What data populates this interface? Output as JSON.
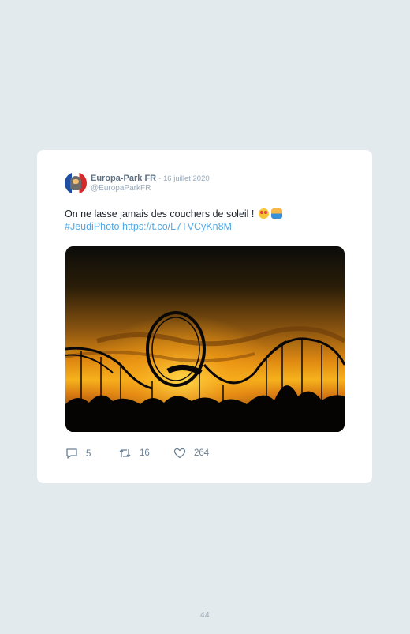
{
  "tweet": {
    "display_name": "Europa-Park FR",
    "date": "16 juillet 2020",
    "handle": "@EuropaParkFR",
    "text": "On ne lasse jamais des couchers de soleil !",
    "emojis": [
      "heart-eyes-emoji",
      "sunrise-emoji"
    ],
    "hashtag": "#JeudiPhoto",
    "link": "https://t.co/L7TVCyKn8M",
    "photo_description_icon": "rollercoaster-sunset-photo"
  },
  "stats": {
    "replies": "5",
    "retweets": "16",
    "likes": "264"
  },
  "page": {
    "number": "44"
  },
  "colors": {
    "background": "#e3eaee",
    "card": "#ffffff",
    "link": "#53a8e2",
    "muted": "#9aabbb"
  }
}
